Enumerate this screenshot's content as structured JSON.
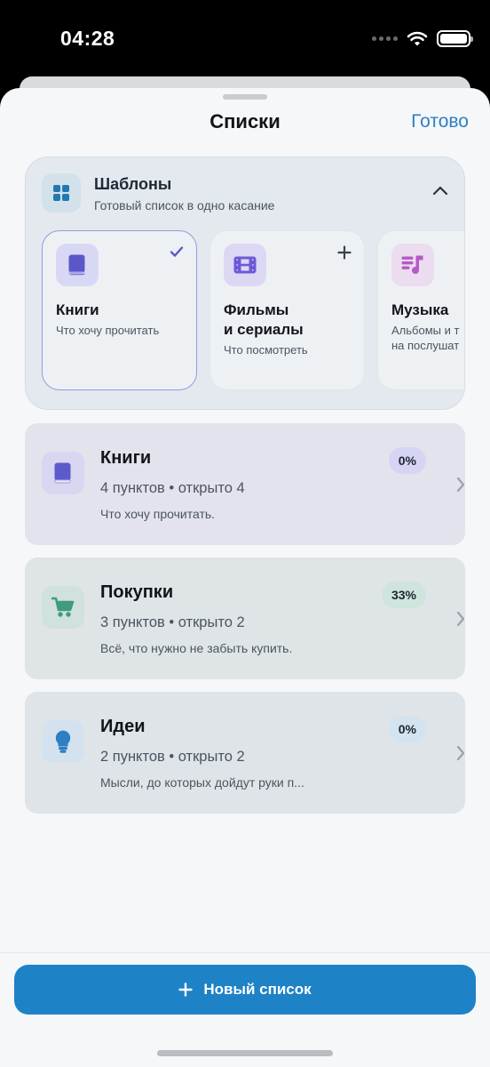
{
  "status_bar": {
    "time": "04:28",
    "icons": [
      "signal-dots",
      "wifi-icon",
      "battery-icon"
    ]
  },
  "header": {
    "title": "Списки",
    "done_label": "Готово"
  },
  "templates": {
    "title": "Шаблоны",
    "subtitle": "Готовый список в одно касание",
    "icon": "grid-icon",
    "collapse_icon": "chevron-up-icon",
    "items": [
      {
        "name": "Книги",
        "description": "Что хочу прочитать",
        "icon": "book-icon",
        "state_icon": "checkmark-icon",
        "selected": true,
        "icon_bg": "#d9d8f4",
        "icon_color": "#5b57c9"
      },
      {
        "name": "Фильмы\nи сериалы",
        "description": "Что посмотреть",
        "icon": "film-icon",
        "state_icon": "plus-icon",
        "selected": false,
        "icon_bg": "#dcd8f4",
        "icon_color": "#6d5ad6"
      },
      {
        "name": "Музыка",
        "description": "Альбомы и т\nна послушат",
        "icon": "music-icon",
        "state_icon": "",
        "selected": false,
        "icon_bg": "#ecdcf0",
        "icon_color": "#b35bc5"
      }
    ]
  },
  "lists": [
    {
      "name": "Книги",
      "meta": "4 пунктов • открыто 4",
      "description": "Что хочу прочитать.",
      "percent": "0%",
      "icon": "book-icon",
      "bg": "#e3e3ee",
      "icon_bg": "#d8d7f2",
      "icon_color": "#5e5acb",
      "badge_bg": "#d6d4f3"
    },
    {
      "name": "Покупки",
      "meta": "3 пунктов • открыто 2",
      "description": "Всё, что нужно не забыть купить.",
      "percent": "33%",
      "icon": "cart-icon",
      "bg": "#dfe5e6",
      "icon_bg": "#d1e1dd",
      "icon_color": "#3f9c7c",
      "badge_bg": "#cfe4dc"
    },
    {
      "name": "Идеи",
      "meta": "2 пунктов • открыто 2",
      "description": "Мысли, до которых дойдут руки п...",
      "percent": "0%",
      "icon": "lightbulb-icon",
      "bg": "#dfe4e9",
      "icon_bg": "#d3e2ee",
      "icon_color": "#2f7fc2",
      "badge_bg": "#d3e3ef"
    }
  ],
  "bottom": {
    "new_list_label": "Новый список",
    "icon": "plus-icon"
  },
  "colors": {
    "accent": "#2f80c4",
    "primary_button": "#1e82c6",
    "sheet_bg": "#f5f7f9"
  }
}
